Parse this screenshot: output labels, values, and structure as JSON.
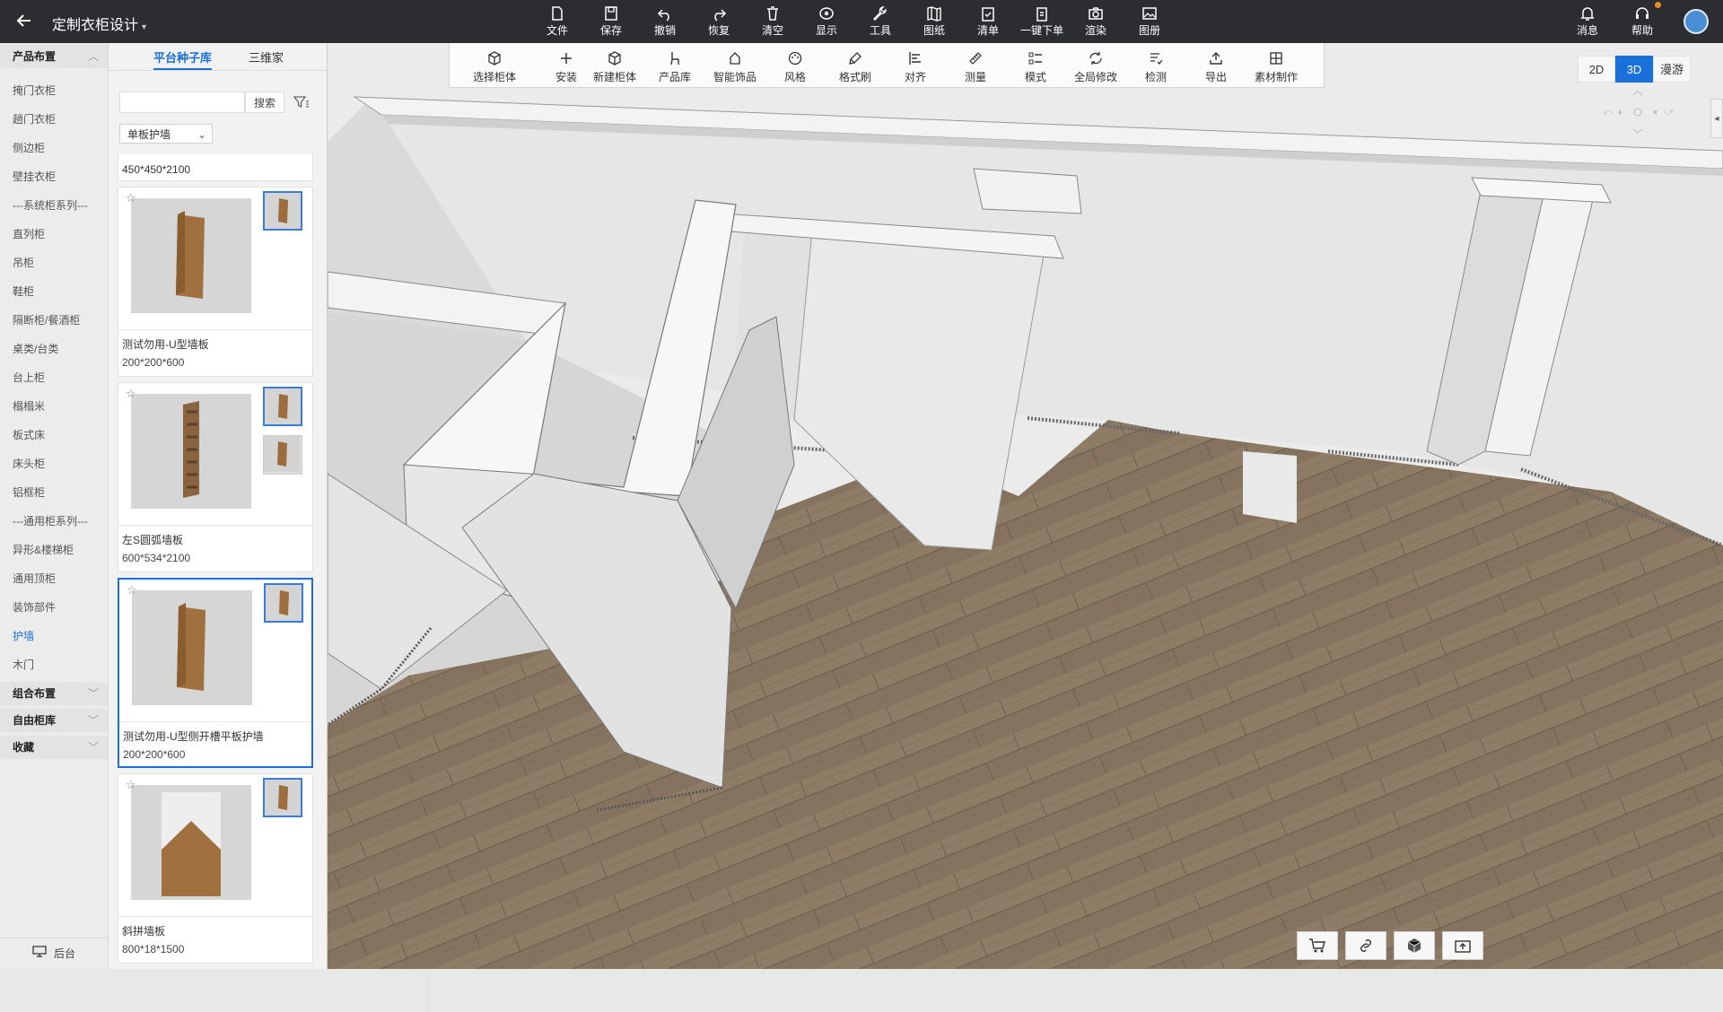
{
  "header": {
    "title": "定制衣柜设计",
    "toolbar": [
      {
        "id": "file",
        "label": "文件",
        "icon": "file-icon"
      },
      {
        "id": "save",
        "label": "保存",
        "icon": "save-icon"
      },
      {
        "id": "undo",
        "label": "撤销",
        "icon": "undo-icon"
      },
      {
        "id": "redo",
        "label": "恢复",
        "icon": "redo-icon"
      },
      {
        "id": "clear",
        "label": "清空",
        "icon": "trash-icon"
      },
      {
        "id": "display",
        "label": "显示",
        "icon": "eye-icon"
      },
      {
        "id": "tools",
        "label": "工具",
        "icon": "wrench-icon"
      },
      {
        "id": "drawing",
        "label": "图纸",
        "icon": "map-icon"
      },
      {
        "id": "list",
        "label": "清单",
        "icon": "clipboard-icon"
      },
      {
        "id": "order",
        "label": "一键下单",
        "icon": "order-icon"
      },
      {
        "id": "render",
        "label": "渲染",
        "icon": "camera-icon"
      },
      {
        "id": "album",
        "label": "图册",
        "icon": "album-icon"
      }
    ],
    "right": [
      {
        "id": "messages",
        "label": "消息",
        "icon": "bell-icon"
      },
      {
        "id": "help",
        "label": "帮助",
        "icon": "headset-icon"
      }
    ]
  },
  "categories": {
    "section_product": "产品布置",
    "items": [
      "掩门衣柜",
      "趟门衣柜",
      "侧边柜",
      "壁挂衣柜",
      "---系统柜系列---",
      "直列柜",
      "吊柜",
      "鞋柜",
      "隔断柜/餐酒柜",
      "桌类/台类",
      "台上柜",
      "榻榻米",
      "板式床",
      "床头柜",
      "铝框柜",
      "---通用柜系列---",
      "异形&楼梯柜",
      "通用顶柜",
      "装饰部件",
      "护墙",
      "木门"
    ],
    "active_item": "护墙",
    "section_combo": "组合布置",
    "section_free": "自由柜库",
    "section_fav": "收藏",
    "backend_label": "后台"
  },
  "library": {
    "tabs": [
      "平台种子库",
      "三维家"
    ],
    "active_tab": "平台种子库",
    "search_placeholder": "",
    "search_button": "搜索",
    "filter_value": "单板护墙",
    "partial_card_dims": "450*450*2100",
    "cards": [
      {
        "name": "测试勿用-U型墙板",
        "dims": "200*200*600",
        "selected": false
      },
      {
        "name": "左S圆弧墙板",
        "dims": "600*534*2100",
        "selected": false
      },
      {
        "name": "测试勿用-U型侧开槽平板护墙",
        "dims": "200*200*600",
        "selected": true
      },
      {
        "name": "斜拼墙板",
        "dims": "800*18*1500",
        "selected": false
      }
    ]
  },
  "subtoolbar": [
    {
      "id": "select-cabinet",
      "label": "选择柜体",
      "icon": "cube-select-icon"
    },
    {
      "id": "install",
      "label": "安装",
      "icon": "plus-icon"
    },
    {
      "id": "new-cabinet",
      "label": "新建柜体",
      "icon": "box-icon"
    },
    {
      "id": "product-lib",
      "label": "产品库",
      "icon": "chair-icon"
    },
    {
      "id": "smart-decor",
      "label": "智能饰品",
      "icon": "decor-icon"
    },
    {
      "id": "style",
      "label": "风格",
      "icon": "palette-icon"
    },
    {
      "id": "format-brush",
      "label": "格式刷",
      "icon": "brush-icon"
    },
    {
      "id": "align",
      "label": "对齐",
      "icon": "align-icon"
    },
    {
      "id": "measure",
      "label": "测量",
      "icon": "ruler-icon"
    },
    {
      "id": "mode",
      "label": "模式",
      "icon": "grid-list-icon"
    },
    {
      "id": "global-edit",
      "label": "全局修改",
      "icon": "global-edit-icon"
    },
    {
      "id": "check",
      "label": "检测",
      "icon": "check-list-icon"
    },
    {
      "id": "export",
      "label": "导出",
      "icon": "export-icon"
    },
    {
      "id": "material",
      "label": "素材制作",
      "icon": "material-icon"
    }
  ],
  "view_modes": [
    "2D",
    "3D",
    "漫游"
  ],
  "active_view": "3D",
  "bottom_tools": [
    {
      "id": "cart",
      "icon": "cart-icon"
    },
    {
      "id": "link",
      "icon": "link-icon"
    },
    {
      "id": "cube",
      "icon": "cube-icon"
    },
    {
      "id": "snapshot",
      "icon": "snapshot-icon"
    }
  ],
  "colors": {
    "accent": "#1a6fd8",
    "topbar": "#2b2d30",
    "floor": "#8a7a66",
    "wall": "#ececec"
  }
}
